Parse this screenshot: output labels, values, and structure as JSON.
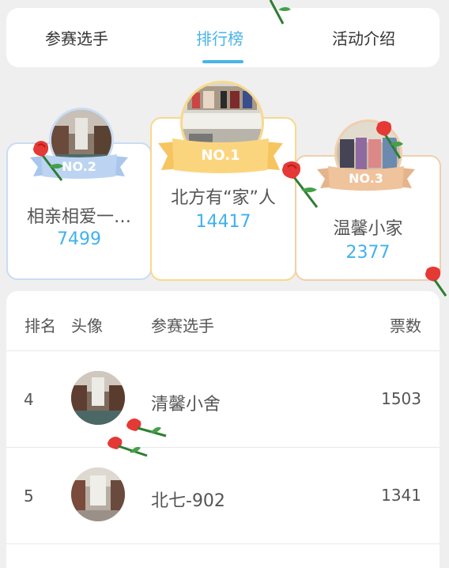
{
  "tabs": [
    "参赛选手",
    "排行榜",
    "活动介绍"
  ],
  "active_tab_color": "#4ab4e8",
  "vote_color": "#3fb2ec",
  "podium": [
    {
      "badge": "NO.2",
      "name": "相亲相爱一…",
      "votes": "7499"
    },
    {
      "badge": "NO.1",
      "name": "北方有“家”人",
      "votes": "14417"
    },
    {
      "badge": "NO.3",
      "name": "温馨小家",
      "votes": "2377"
    }
  ],
  "list": {
    "headers": {
      "rank": "排名",
      "avatar": "头像",
      "name": "参赛选手",
      "votes": "票数"
    },
    "rows": [
      {
        "rank": "4",
        "name": "清馨小舍",
        "votes": "1503"
      },
      {
        "rank": "5",
        "name": "北七-902",
        "votes": "1341"
      }
    ]
  },
  "decorations": {
    "rose": "rose-icon"
  }
}
